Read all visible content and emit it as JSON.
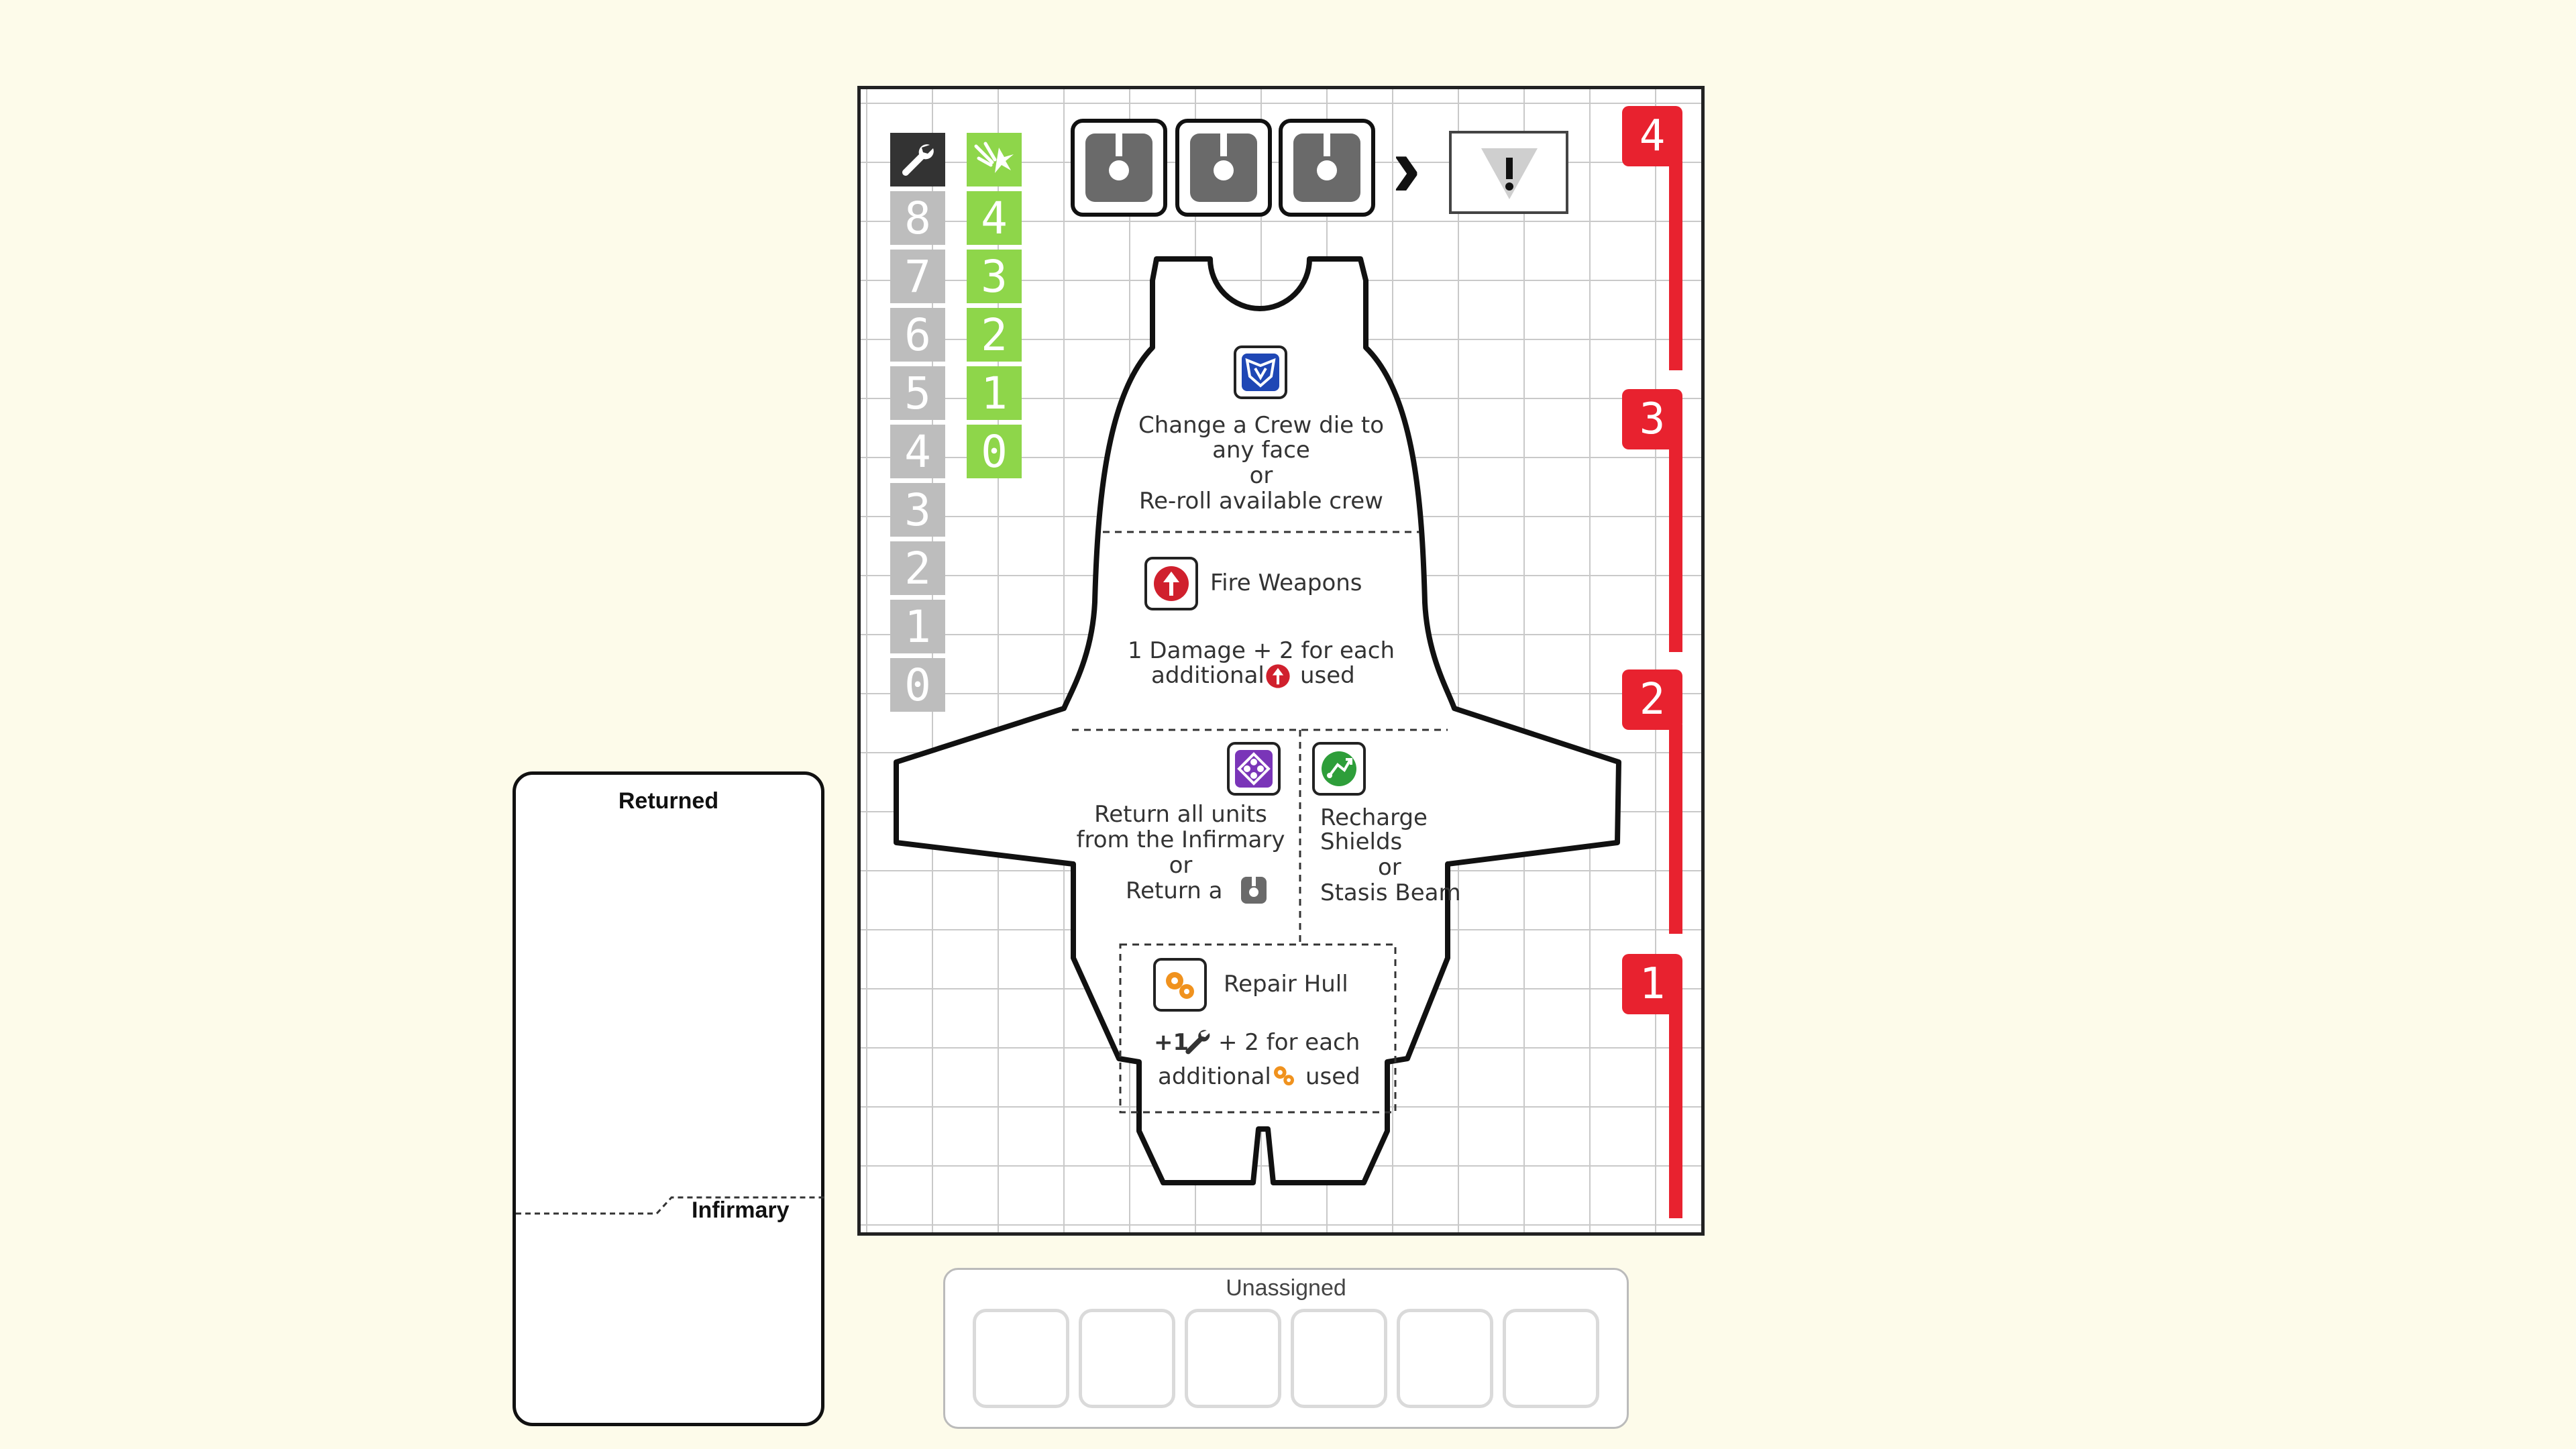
{
  "hull_track": {
    "icon": "wrench-icon",
    "values": [
      "8",
      "7",
      "6",
      "5",
      "4",
      "3",
      "2",
      "1",
      "0"
    ]
  },
  "shield_track": {
    "icon": "shield-deflect-icon",
    "values": [
      "4",
      "3",
      "2",
      "1",
      "0"
    ]
  },
  "crew_slots": [
    "crew-die",
    "crew-die",
    "crew-die"
  ],
  "threat_arrow": "›",
  "threat_card_icon": "warning-icon",
  "stations": {
    "command": {
      "icon": "command-icon",
      "text_1": "Change a Crew die to",
      "text_2": "any face",
      "text_3": "or",
      "text_4": "Re-roll available crew"
    },
    "tactical": {
      "icon": "weapons-icon",
      "title": "Fire Weapons",
      "text_1": "1 Damage + 2 for each",
      "text_2": "additional",
      "text_3": "used"
    },
    "medical": {
      "icon": "medical-icon",
      "text_1": "Return all units",
      "text_2": "from the Infirmary",
      "text_3": "or",
      "text_4": "Return a"
    },
    "science": {
      "icon": "science-icon",
      "text_1": "Recharge",
      "text_2": "Shields",
      "text_3": "or",
      "text_4": "Stasis Beam"
    },
    "engineering": {
      "icon": "gears-icon",
      "title": "Repair Hull",
      "text_1": "+1",
      "text_2": "+ 2 for each",
      "text_3": "additional",
      "text_4": "used"
    }
  },
  "threat_levels": [
    "4",
    "3",
    "2",
    "1"
  ],
  "returned_panel": {
    "title": "Returned",
    "infirmary_label": "Infirmary"
  },
  "unassigned_panel": {
    "title": "Unassigned",
    "slots": 6
  },
  "colors": {
    "background": "#fdfbea",
    "hull_gray": "#bdbdbd",
    "shield_green": "#8ed64a",
    "threat_red": "#e8222f",
    "command_blue": "#1f47b5",
    "tactical_red": "#d0202d",
    "medical_purple": "#7a35b8",
    "science_green": "#2e9e3a",
    "engineering_orange": "#f0921e"
  }
}
